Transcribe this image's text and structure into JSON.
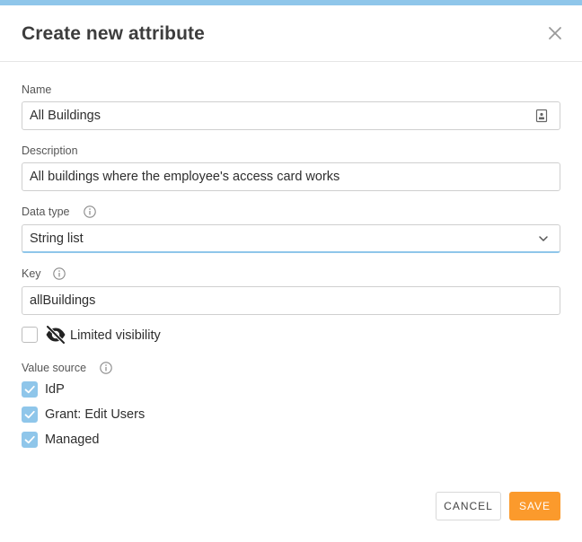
{
  "dialog": {
    "title": "Create new attribute",
    "close_icon": "close-icon"
  },
  "fields": {
    "name": {
      "label": "Name",
      "value": "All Buildings",
      "trailing_icon": "contact-card-icon"
    },
    "description": {
      "label": "Description",
      "value": "All buildings where the employee's access card works"
    },
    "data_type": {
      "label": "Data type",
      "info_icon": "info-icon",
      "value": "String list",
      "dropdown_icon": "chevron-down-icon"
    },
    "key": {
      "label": "Key",
      "info_icon": "info-icon",
      "value": "allBuildings"
    }
  },
  "limited_visibility": {
    "label": "Limited visibility",
    "checked": false,
    "icon": "eye-off-icon"
  },
  "value_source": {
    "label": "Value source",
    "info_icon": "info-icon",
    "options": [
      {
        "label": "IdP",
        "checked": true
      },
      {
        "label": "Grant: Edit Users",
        "checked": true
      },
      {
        "label": "Managed",
        "checked": true
      }
    ]
  },
  "actions": {
    "cancel_label": "CANCEL",
    "save_label": "SAVE"
  },
  "colors": {
    "accent": "#8fc6ea",
    "primary": "#fb9a2c",
    "border": "#cfcfcf"
  }
}
